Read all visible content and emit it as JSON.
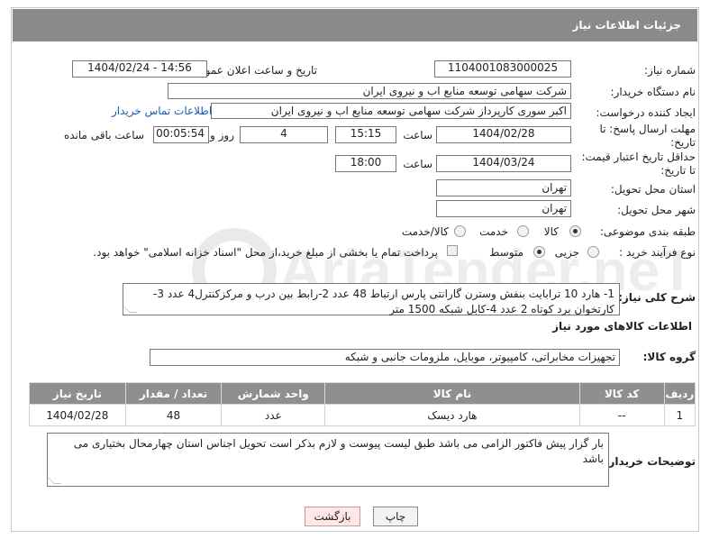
{
  "header": {
    "title": "جزئیات اطلاعات نیاز"
  },
  "fields": {
    "need_number_label": "شماره نیاز:",
    "need_number": "1104001083000025",
    "announce_label": "تاریخ و ساعت اعلان عمومی:",
    "announce_value": "1404/02/24 - 14:56",
    "buyer_org_label": "نام دستگاه خریدار:",
    "buyer_org": "شرکت سهامی توسعه منابع اب و نیروی ایران",
    "creator_label": "ایجاد کننده درخواست:",
    "creator": "اکبر سوری کارپرداز شرکت سهامی توسعه منابع اب و نیروی ایران",
    "contact_link": "اطلاعات تماس خریدار",
    "deadline_label_1": "مهلت ارسال پاسخ: تا",
    "deadline_label_2": "تاریخ:",
    "deadline_date": "1404/02/28",
    "time_label": "ساعت",
    "deadline_time": "15:15",
    "days_value": "4",
    "days_label": "روز و",
    "remaining_time": "00:05:54",
    "remaining_label": "ساعت باقی مانده",
    "validity_label_1": "حداقل تاریخ اعتبار قیمت:",
    "validity_label_2": "تا تاریخ:",
    "validity_date": "1404/03/24",
    "validity_time": "18:00",
    "province_label": "استان محل تحویل:",
    "province": "تهران",
    "city_label": "شهر محل تحویل:",
    "city": "تهران",
    "category_label": "طبقه بندی موضوعی:",
    "category_options": [
      "کالا",
      "خدمت",
      "کالا/خدمت"
    ],
    "process_label": "نوع فرآیند خرید :",
    "process_options": [
      "جزیی",
      "متوسط"
    ],
    "payment_note": "پرداخت تمام یا بخشی از مبلغ خرید،از محل \"اسناد خزانه اسلامی\" خواهد بود."
  },
  "general_desc": {
    "label": "شرح کلی نیاز:",
    "text": "1- هارد 10 ترابایت بنفش وسترن گارانتی پارس ارتباط 48 عدد 2-رابط بین درب و مرکزکنترل4 عدد 3-کارتخوان برد کوتاه 2 عدد 4-کابل شبکه 1500 متر"
  },
  "goods_section": {
    "title": "اطلاعات کالاهای مورد نیاز",
    "group_label": "گروه کالا:",
    "group_value": "تجهیزات مخابراتی، کامپیوتر، موبایل، ملزومات جانبی و شبکه"
  },
  "table": {
    "headers": [
      "ردیف",
      "کد کالا",
      "نام کالا",
      "واحد شمارش",
      "تعداد / مقدار",
      "تاریخ نیاز"
    ],
    "rows": [
      [
        "1",
        "--",
        "هارد دیسک",
        "عدد",
        "48",
        "1404/02/28"
      ]
    ]
  },
  "buyer_notes": {
    "label": "توضیحات خریدار:",
    "text": "بار گزار پیش فاکتور الزامی می باشد طبق لیست پیوست و لازم بذکر است تحویل اجناس استان چهارمحال بختیاری می باشد"
  },
  "buttons": {
    "print": "چاپ",
    "back": "بازگشت"
  },
  "watermark": {
    "text": "AriaTender.neT"
  }
}
